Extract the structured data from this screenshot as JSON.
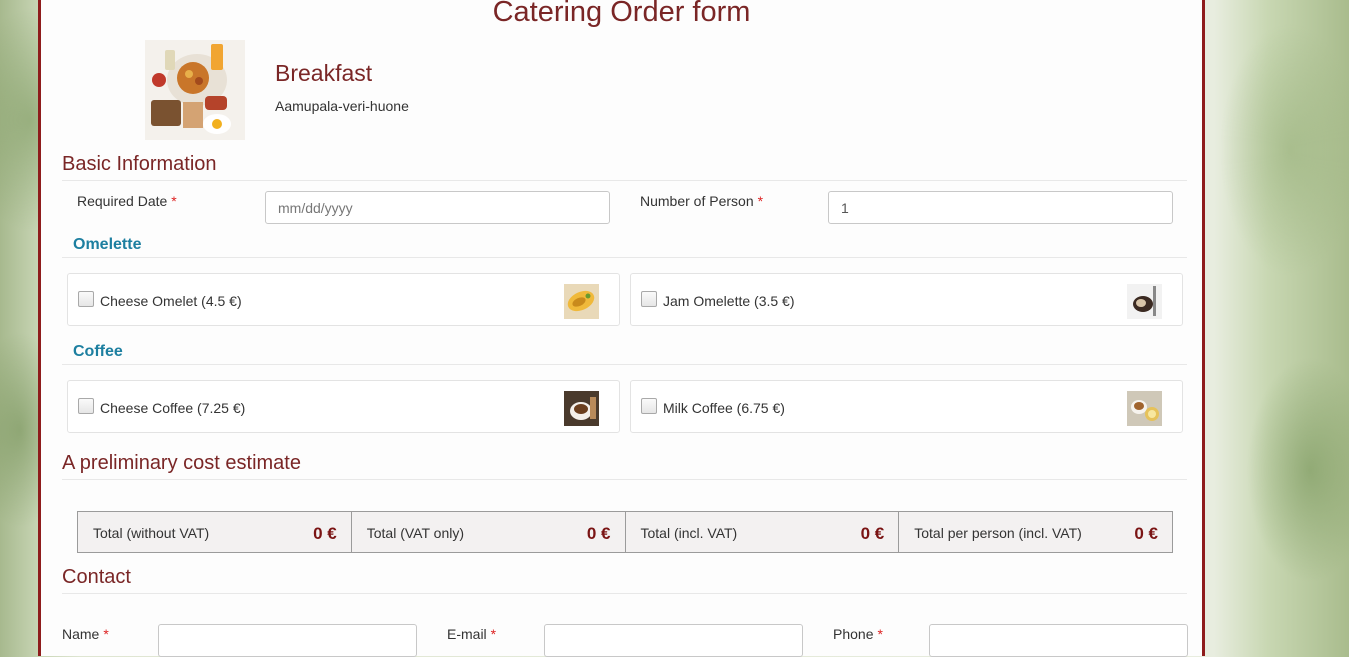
{
  "page": {
    "title": "Catering Order form"
  },
  "hero": {
    "name": "Breakfast",
    "location": "Aamupala-veri-huone",
    "image_icon": "breakfast-photo"
  },
  "basic": {
    "heading": "Basic Information",
    "date_label": "Required Date",
    "date_placeholder": "mm/dd/yyyy",
    "date_value": "",
    "persons_label": "Number of Person",
    "persons_value": "1",
    "required_mark": "*"
  },
  "categories": [
    {
      "name": "Omelette",
      "items": [
        {
          "label": "Cheese Omelet (4.5 €)",
          "checked": false,
          "icon": "omelet-photo"
        },
        {
          "label": "Jam Omelette (3.5 €)",
          "checked": false,
          "icon": "omelette-photo"
        }
      ]
    },
    {
      "name": "Coffee",
      "items": [
        {
          "label": "Cheese Coffee (7.25 €)",
          "checked": false,
          "icon": "coffee-photo"
        },
        {
          "label": "Milk Coffee (6.75 €)",
          "checked": false,
          "icon": "milk-coffee-photo"
        }
      ]
    }
  ],
  "estimate": {
    "heading": "A preliminary cost estimate",
    "cells": [
      {
        "label": "Total (without VAT)",
        "value": "0 €"
      },
      {
        "label": "Total (VAT only)",
        "value": "0 €"
      },
      {
        "label": "Total (incl. VAT)",
        "value": "0 €"
      },
      {
        "label": "Total per person (incl. VAT)",
        "value": "0 €"
      }
    ]
  },
  "contact": {
    "heading": "Contact",
    "name_label": "Name",
    "email_label": "E-mail",
    "phone_label": "Phone"
  },
  "colors": {
    "accent": "#7a2626",
    "category": "#1d7fa0",
    "border": "#8e1c1c",
    "required": "#dd2222"
  }
}
